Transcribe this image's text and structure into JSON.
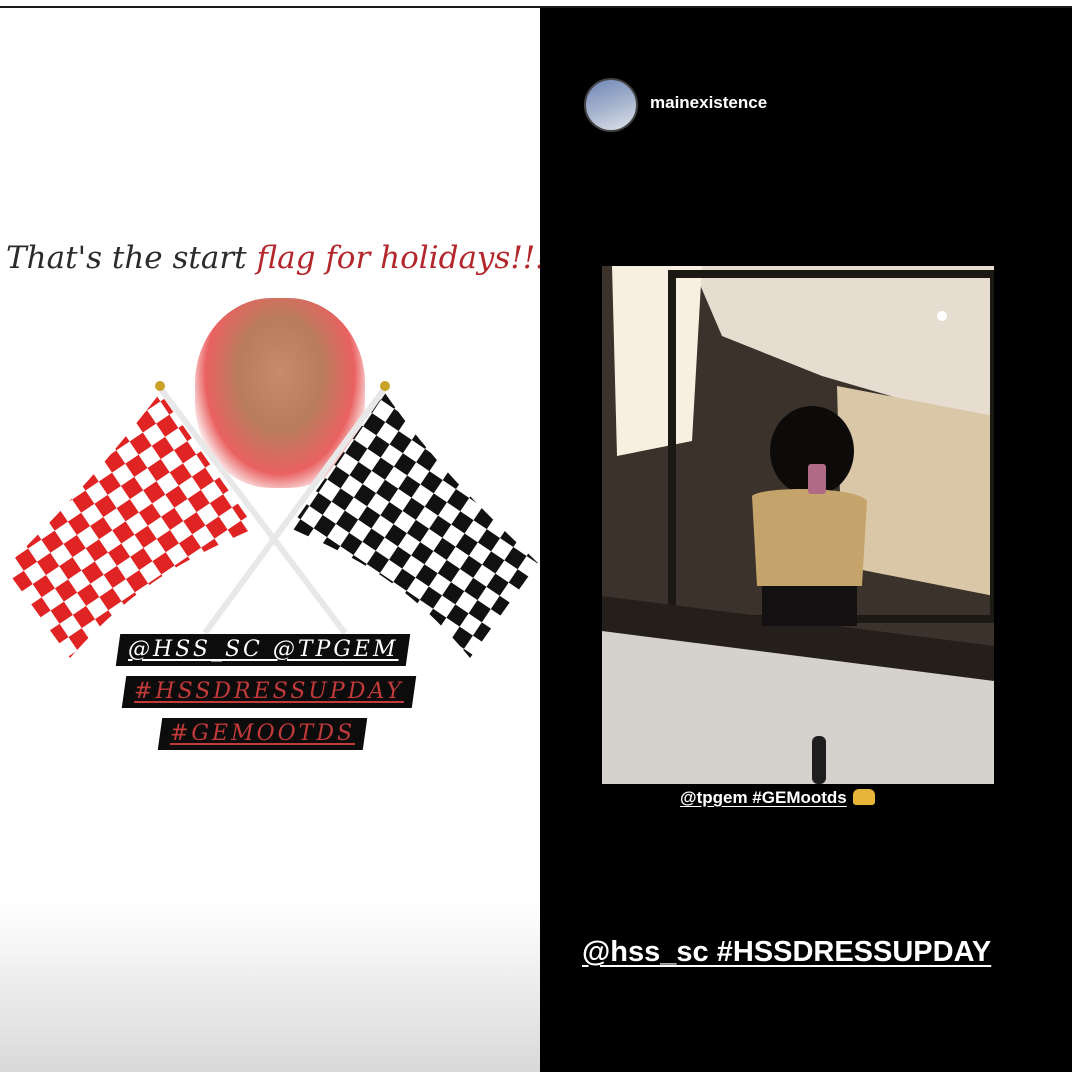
{
  "left": {
    "caption_start": "That's the start ",
    "caption_accent": "flag for holidays!!!",
    "tag_line_1": "@HSS_SC @TPGEM",
    "tag_line_2": "#HSSDRESSUPDAY",
    "tag_line_3": "#GEMOOTDS"
  },
  "right": {
    "username": "mainexistence",
    "mention_line": "@tpgem #GEMootds",
    "emoji_icon": "raised-hands-icon",
    "big_tag": "@hss_sc #HSSDRESSUPDAY"
  },
  "colors": {
    "accent_red": "#b3262b",
    "flag_red": "#e02424",
    "flag_black": "#111111",
    "right_bg": "#000000"
  }
}
